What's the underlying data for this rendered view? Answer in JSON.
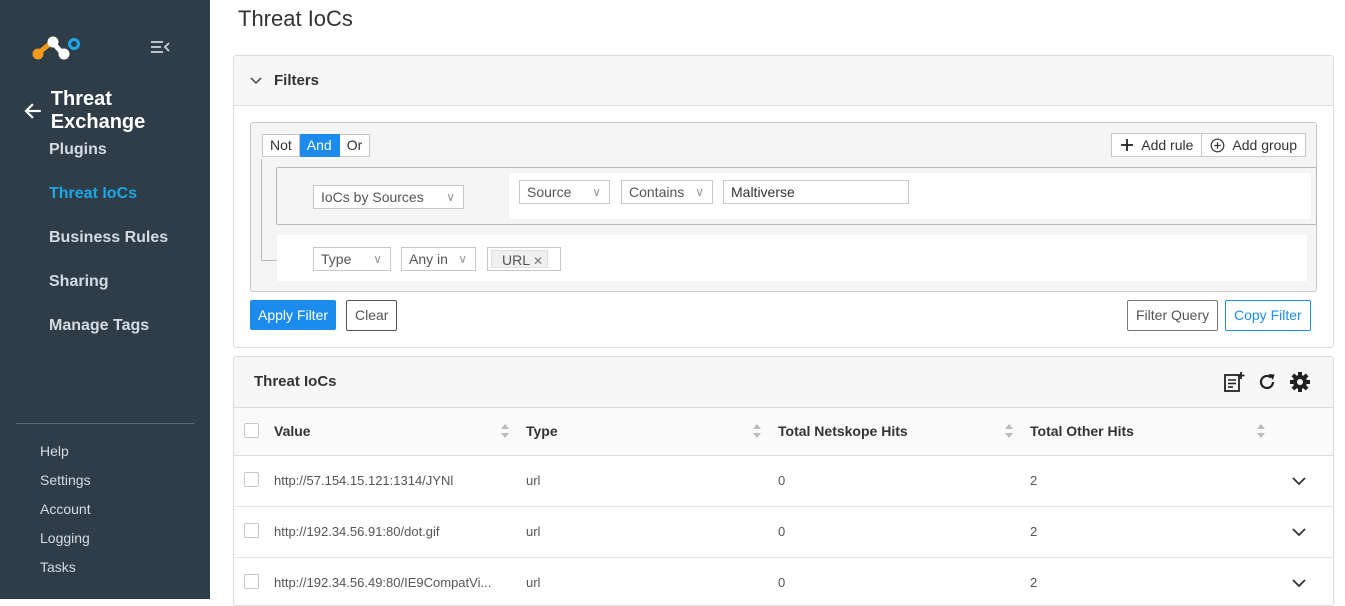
{
  "sidebar": {
    "back_label": "Threat Exchange",
    "items": [
      {
        "label": "Plugins",
        "active": false
      },
      {
        "label": "Threat IoCs",
        "active": true
      },
      {
        "label": "Business Rules",
        "active": false
      },
      {
        "label": "Sharing",
        "active": false
      },
      {
        "label": "Manage Tags",
        "active": false
      }
    ],
    "bottom_items": [
      "Help",
      "Settings",
      "Account",
      "Logging",
      "Tasks"
    ],
    "colors": {
      "background": "#2f3d48",
      "active": "#1ba6e8"
    }
  },
  "page": {
    "title": "Threat IoCs"
  },
  "filters": {
    "header": "Filters",
    "conjunctions": [
      {
        "label": "Not",
        "active": false
      },
      {
        "label": "And",
        "active": true
      },
      {
        "label": "Or",
        "active": false
      }
    ],
    "add_rule_label": "Add rule",
    "add_group_label": "Add group",
    "group": {
      "field": "IoCs by Sources",
      "rule": {
        "field": "Source",
        "operator": "Contains",
        "value": "Maltiverse"
      }
    },
    "rule": {
      "field": "Type",
      "operator": "Any in",
      "tag": "URL"
    },
    "apply_label": "Apply Filter",
    "clear_label": "Clear",
    "filter_query_label": "Filter Query",
    "copy_filter_label": "Copy Filter"
  },
  "table": {
    "title": "Threat IoCs",
    "columns": [
      "Value",
      "Type",
      "Total Netskope Hits",
      "Total Other Hits"
    ],
    "rows": [
      {
        "value": "http://57.154.15.121:1314/JYNl",
        "type": "url",
        "netskope_hits": "0",
        "other_hits": "2"
      },
      {
        "value": "http://192.34.56.91:80/dot.gif",
        "type": "url",
        "netskope_hits": "0",
        "other_hits": "2"
      },
      {
        "value": "http://192.34.56.49:80/IE9CompatVi...",
        "type": "url",
        "netskope_hits": "0",
        "other_hits": "2"
      }
    ]
  },
  "colors": {
    "primary": "#1b8ced"
  }
}
